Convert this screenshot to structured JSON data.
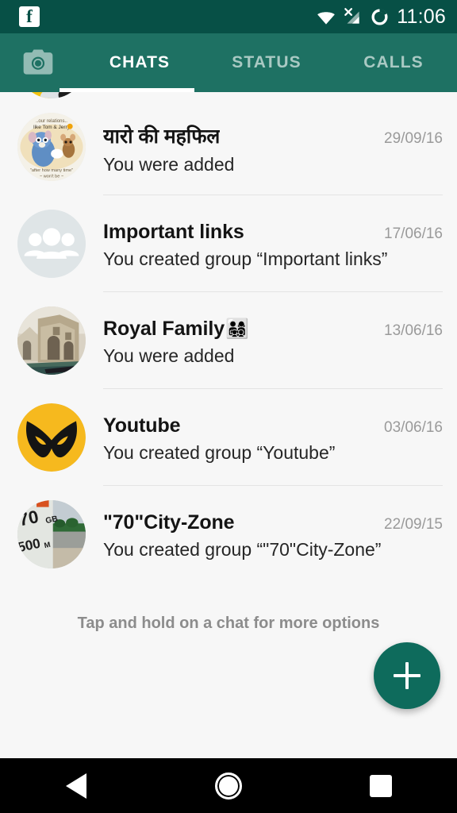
{
  "statusbar": {
    "app_icon": "facebook-icon",
    "wifi_icon": "wifi-icon",
    "cell_icon": "cell-signal-no-sim-icon",
    "battery_icon": "battery-ring-icon",
    "time": "11:06"
  },
  "tabbar": {
    "camera_icon": "camera-icon",
    "tabs": [
      {
        "label": "CHATS",
        "active": true
      },
      {
        "label": "STATUS",
        "active": false
      },
      {
        "label": "CALLS",
        "active": false
      }
    ]
  },
  "chats": [
    {
      "title": "यारो की महफिल",
      "title_emoji": "",
      "subtitle": "You were added",
      "date": "29/09/16",
      "avatar": "tom-and-jerry-meme-photo"
    },
    {
      "title": "Important links",
      "title_emoji": "",
      "subtitle": "You created group “Important links”",
      "date": "17/06/16",
      "avatar": "default-group-icon"
    },
    {
      "title": "Royal Family",
      "title_emoji": "👨‍👩‍👧‍👦",
      "subtitle": "You were added",
      "date": "13/06/16",
      "avatar": "old-stone-canal-photo"
    },
    {
      "title": "Youtube",
      "title_emoji": "",
      "subtitle": "You created group “Youtube”",
      "date": "03/06/16",
      "avatar": "yellow-wolverine-mask-logo"
    },
    {
      "title": "\"70\"City-Zone",
      "title_emoji": "",
      "subtitle": "You created group “\"70\"City-Zone”",
      "date": "22/09/15",
      "avatar": "highway-milestone-70-photo"
    }
  ],
  "hint": "Tap and hold on a chat for more options",
  "fab": {
    "icon": "plus-icon",
    "label": "New chat"
  },
  "navbar": {
    "back": "back-icon",
    "home": "home-icon",
    "recents": "recents-icon"
  },
  "colors": {
    "statusbar_bg": "#075046",
    "tabbar_bg": "#1e7163",
    "accent": "#0e6b5c",
    "list_bg": "#f7f7f7",
    "title": "#141414",
    "date": "#9a9a9a"
  }
}
